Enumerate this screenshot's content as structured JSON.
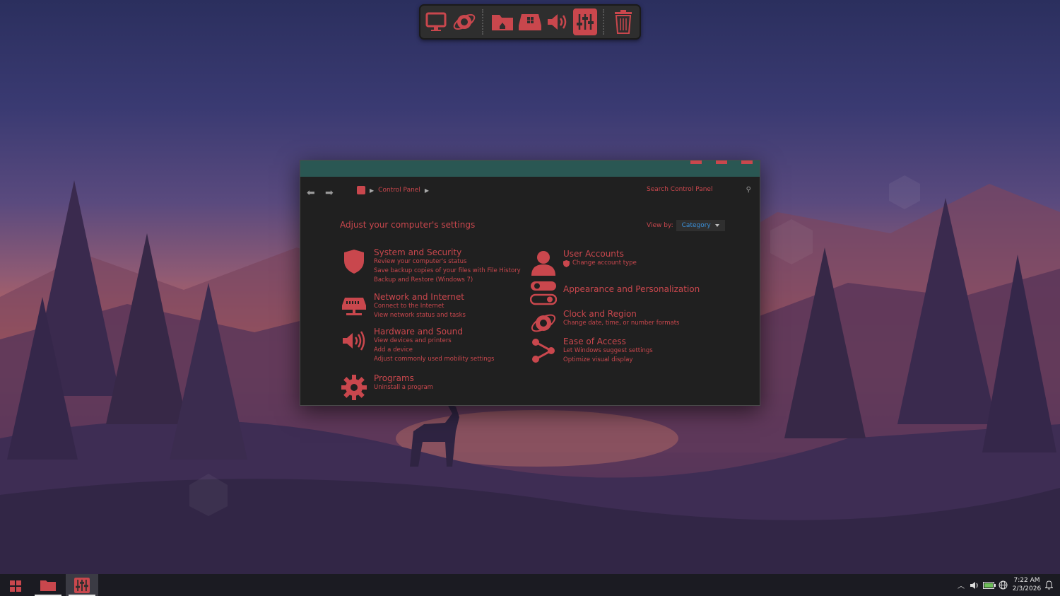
{
  "dock": {
    "items": [
      {
        "name": "computer-icon"
      },
      {
        "name": "network-globe-icon"
      },
      {
        "name": "home-folder-icon"
      },
      {
        "name": "drive-icon"
      },
      {
        "name": "speaker-icon"
      },
      {
        "name": "control-panel-icon",
        "active": true
      },
      {
        "name": "recycle-bin-icon"
      }
    ]
  },
  "window": {
    "breadcrumb": [
      "Control Panel"
    ],
    "search_placeholder": "Search Control Panel",
    "heading": "Adjust your computer's settings",
    "view_by_label": "View by:",
    "view_by_value": "Category",
    "categories": [
      {
        "title": "System and Security",
        "icon": "shield-icon",
        "links": [
          "Review your computer's status",
          "Save backup copies of your files with File History",
          "Backup and Restore (Windows 7)"
        ]
      },
      {
        "title": "Network and Internet",
        "icon": "network-icon",
        "links": [
          "Connect to the Internet",
          "View network status and tasks"
        ]
      },
      {
        "title": "Hardware and Sound",
        "icon": "speaker-icon",
        "links": [
          "View devices and printers",
          "Add a device",
          "Adjust commonly used mobility settings"
        ]
      },
      {
        "title": "Programs",
        "icon": "gear-icon",
        "links": [
          "Uninstall a program"
        ]
      },
      {
        "title": "User Accounts",
        "icon": "user-icon",
        "links": [
          "Change account type"
        ]
      },
      {
        "title": "Appearance and Personalization",
        "icon": "toggle-icon",
        "links": []
      },
      {
        "title": "Clock and Region",
        "icon": "globe-icon",
        "links": [
          "Change date, time, or number formats"
        ]
      },
      {
        "title": "Ease of Access",
        "icon": "share-icon",
        "links": [
          "Let Windows suggest settings",
          "Optimize visual display"
        ]
      }
    ]
  },
  "taskbar": {
    "clock_time": "7:22 AM",
    "clock_date": "2/3/2026"
  },
  "colors": {
    "accent": "#c9474d",
    "titlebar": "#2a5753",
    "window_bg": "#202020",
    "link_blue": "#3a8fd8"
  }
}
